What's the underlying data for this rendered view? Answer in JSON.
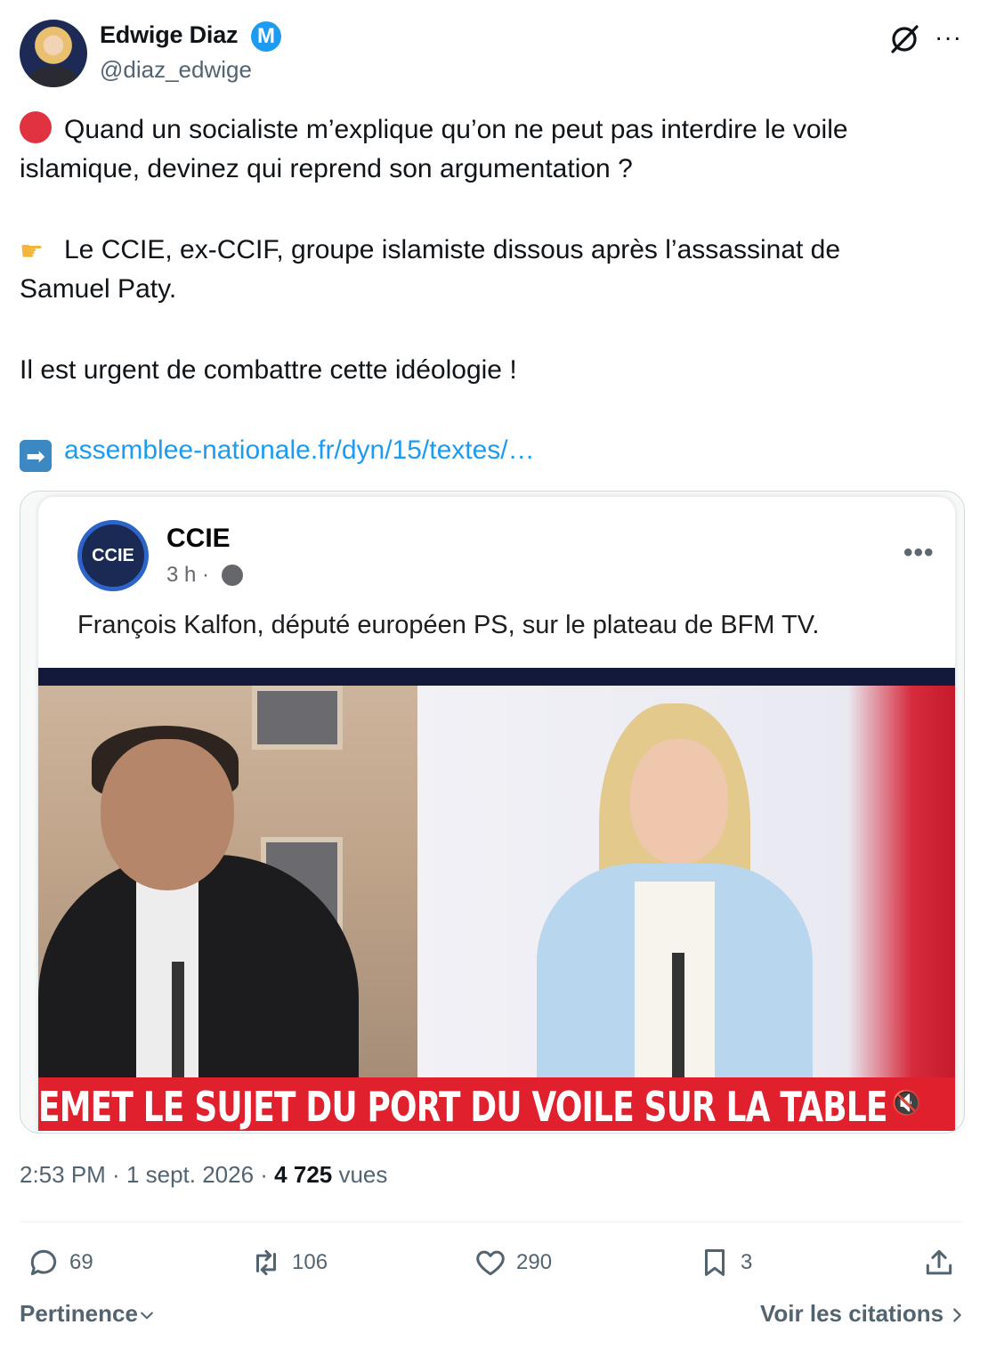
{
  "author": {
    "name": "Edwige Diaz",
    "badge": "M",
    "handle": "@diaz_edwige"
  },
  "tweet": {
    "line1": "Quand un socialiste m’explique qu’on ne peut pas interdire le voile",
    "line2": "islamique, devinez qui reprend son argumentation ?",
    "line3": "Le CCIE, ex-CCIF, groupe islamiste dissous après l’assassinat de",
    "line4": "Samuel Paty.",
    "line5": "Il est urgent de combattre cette idéologie !",
    "link": "assemblee-nationale.fr/dyn/15/textes/…",
    "pointer_glyph": "☛",
    "arrow_glyph": "➡"
  },
  "embed": {
    "page_logo": "CCIE",
    "page_name": "CCIE",
    "time": "3 h ·",
    "more": "•••",
    "caption": "François Kalfon, député européen PS, sur le plateau de BFM TV.",
    "ticker": "EMET LE SUJET DU PORT DU VOILE SUR LA TABLE",
    "mute_glyph": "🔇"
  },
  "meta": {
    "time": "2:53 PM",
    "sep1": " · ",
    "date": "1 sept. 2026",
    "sep2": " · ",
    "views": "4 725",
    "views_label": " vues"
  },
  "actions": {
    "replies": "69",
    "reposts": "106",
    "likes": "290",
    "bookmarks": "3"
  },
  "footer": {
    "sort": "Pertinence",
    "quotes": "Voir les citations"
  },
  "header_more": "···",
  "colors": {
    "link": "#1d9bf0",
    "ticker": "#e0202d",
    "muted": "#536471"
  }
}
